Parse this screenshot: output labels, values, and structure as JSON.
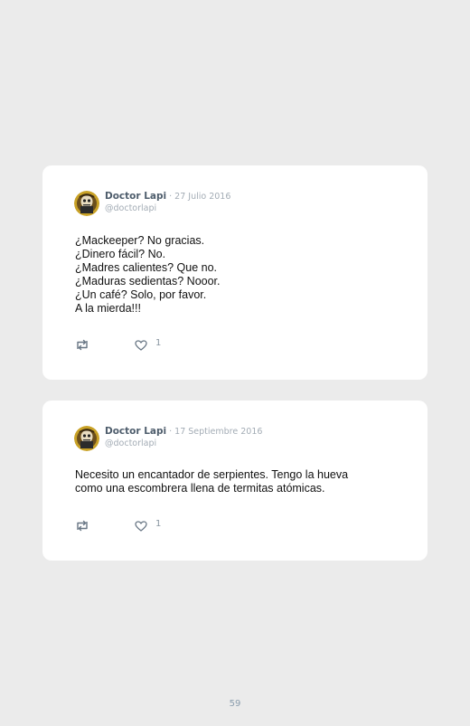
{
  "tweets": [
    {
      "author": "Doctor Lapi",
      "date": "· 27 Julio 2016",
      "handle": "@doctorlapi",
      "lines": [
        "¿Mackeeper? No gracias.",
        "¿Dinero fácil? No.",
        "¿Madres calientes? Que no.",
        "¿Maduras sedientas? Nooor.",
        "¿Un café? Solo, por favor.",
        "A la mierda!!!"
      ],
      "likes": "1",
      "icons": {
        "retweet": "retweet-icon",
        "like": "heart-icon",
        "avatar": "doctor-avatar"
      }
    },
    {
      "author": "Doctor Lapi",
      "date": "· 17 Septiembre 2016",
      "handle": "@doctorlapi",
      "lines": [
        "Necesito un encantador de serpientes. Tengo la hueva",
        "como una escombrera llena de termitas atómicas."
      ],
      "likes": "1",
      "icons": {
        "retweet": "retweet-icon",
        "like": "heart-icon",
        "avatar": "doctor-avatar"
      }
    }
  ],
  "page": {
    "number": "59"
  },
  "colors": {
    "background": "#ebebeb",
    "card": "#ffffff",
    "author": "#4e5d6c",
    "muted": "#a3acb5",
    "text": "#111111",
    "icon": "#687684"
  }
}
